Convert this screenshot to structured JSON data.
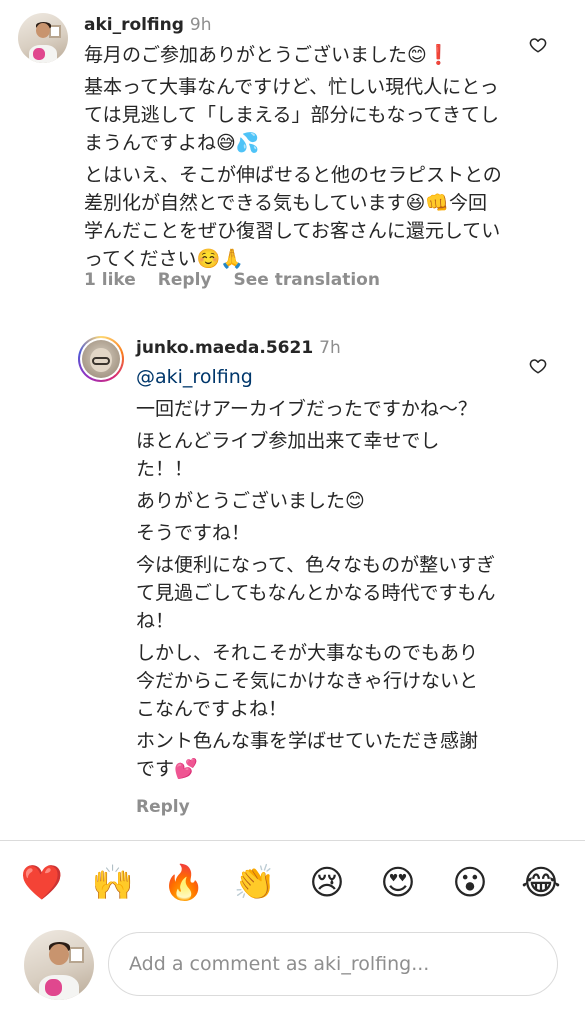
{
  "comment1": {
    "username": "aki_rolfing",
    "time": "9h",
    "paragraphs": [
      "毎月のご参加ありがとうございました😊❗️",
      "基本って大事なんですけど、忙しい現代人にとっては見逃して「しまえる」部分にもなってきてしまうんですよね😅💦",
      "とはいえ、そこが伸ばせると他のセラピストとの差別化が自然とできる気もしています😆👊今回学んだことをぜひ復習してお客さんに還元していってください☺️🙏"
    ],
    "likes_label": "1 like",
    "reply_label": "Reply",
    "translation_label": "See translation"
  },
  "comment2": {
    "username": "junko.maeda.5621",
    "time": "7h",
    "mention": "@aki_rolfing",
    "paragraphs": [
      "一回だけアーカイブだったですかね〜？",
      "ほとんどライブ参加出来て幸せでした！！",
      "ありがとうございました😊",
      "そうですね！",
      "今は便利になって、色々なものが整いすぎて見過ごしてもなんとかなる時代ですもんね！",
      "しかし、それこそが大事なものでもあり今だからこそ気にかけなきゃ行けないとこなんですよね！",
      "ホント色んな事を学ばせていただき感謝です💕"
    ],
    "reply_label": "Reply"
  },
  "emoji_bar": [
    "❤️",
    "🙌",
    "🔥",
    "👏",
    "😢",
    "😍",
    "😮",
    "😂"
  ],
  "comment_input": {
    "placeholder": "Add a comment as aki_rolfing..."
  },
  "icons": {
    "like": "heart-outline-icon"
  },
  "colors": {
    "text": "#262626",
    "muted": "#8e8e8e",
    "mention": "#00376b",
    "border": "#dbdbdb"
  }
}
